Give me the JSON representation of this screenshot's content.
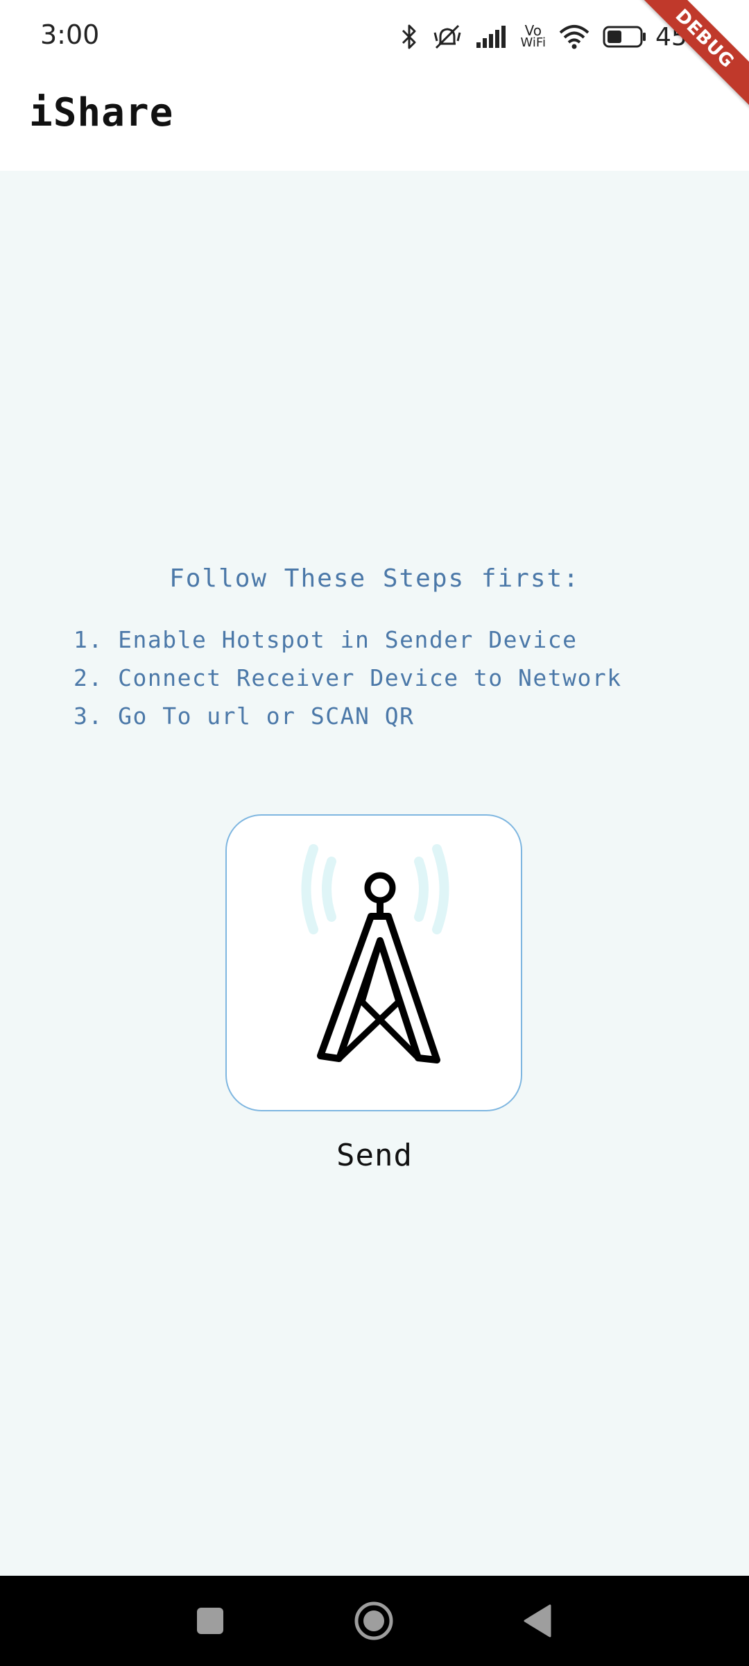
{
  "status_bar": {
    "time": "3:00",
    "battery_percent": "45%",
    "vowifi_top": "Vo",
    "vowifi_bottom": "WiFi",
    "icons": [
      "bluetooth-icon",
      "vibrate-off-icon",
      "cellular-signal-icon",
      "vowifi-icon",
      "wifi-icon",
      "battery-icon"
    ]
  },
  "debug_banner": "DEBUG",
  "app_bar": {
    "title": "iShare"
  },
  "instructions": {
    "heading": "Follow These Steps first:",
    "steps": [
      "1. Enable Hotspot in Sender Device",
      "2. Connect Receiver Device to Network",
      "3. Go To url or SCAN QR"
    ]
  },
  "send": {
    "icon": "antenna-tower-icon",
    "label": "Send"
  },
  "nav_bar": {
    "icons": [
      "recents-square-icon",
      "home-circle-icon",
      "back-triangle-icon"
    ]
  },
  "colors": {
    "content_background": "#f2f8f8",
    "instruction_text": "#4b78a8",
    "button_border": "#7eb6e0",
    "signal_waves": "#dff5f7",
    "debug_ribbon": "#c0392b"
  }
}
